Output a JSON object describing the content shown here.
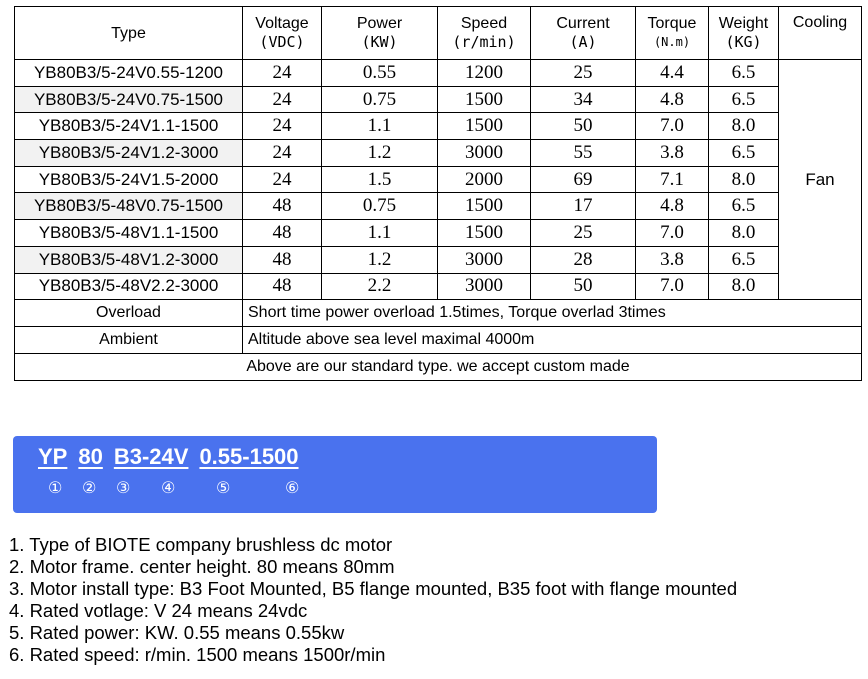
{
  "table": {
    "headers": [
      {
        "label": "Type",
        "unit": ""
      },
      {
        "label": "Voltage",
        "unit": "(VDC)"
      },
      {
        "label": "Power",
        "unit": "(KW)"
      },
      {
        "label": "Speed",
        "unit": "(r/min)"
      },
      {
        "label": "Current",
        "unit": "(A)"
      },
      {
        "label": "Torque",
        "unit": "(N.m)"
      },
      {
        "label": "Weight",
        "unit": "(KG)"
      },
      {
        "label": "Cooling",
        "unit": ""
      }
    ],
    "rows": [
      [
        "YB80B3/5-24V0.55-1200",
        "24",
        "0.55",
        "1200",
        "25",
        "4.4",
        "6.5"
      ],
      [
        "YB80B3/5-24V0.75-1500",
        "24",
        "0.75",
        "1500",
        "34",
        "4.8",
        "6.5"
      ],
      [
        "YB80B3/5-24V1.1-1500",
        "24",
        "1.1",
        "1500",
        "50",
        "7.0",
        "8.0"
      ],
      [
        "YB80B3/5-24V1.2-3000",
        "24",
        "1.2",
        "3000",
        "55",
        "3.8",
        "6.5"
      ],
      [
        "YB80B3/5-24V1.5-2000",
        "24",
        "1.5",
        "2000",
        "69",
        "7.1",
        "8.0"
      ],
      [
        "YB80B3/5-48V0.75-1500",
        "48",
        "0.75",
        "1500",
        "17",
        "4.8",
        "6.5"
      ],
      [
        "YB80B3/5-48V1.1-1500",
        "48",
        "1.1",
        "1500",
        "25",
        "7.0",
        "8.0"
      ],
      [
        "YB80B3/5-48V1.2-3000",
        "48",
        "1.2",
        "3000",
        "28",
        "3.8",
        "6.5"
      ],
      [
        "YB80B3/5-48V2.2-3000",
        "48",
        "2.2",
        "3000",
        "50",
        "7.0",
        "8.0"
      ]
    ],
    "cooling": "Fan",
    "overload_label": "Overload",
    "overload_text": "Short time power overload 1.5times, Torque overlad 3times",
    "ambient_label": "Ambient",
    "ambient_text": "Altitude above sea level maximal 4000m",
    "footer": "Above are our standard type. we accept custom made"
  },
  "code": {
    "segments": [
      "YP",
      "80",
      "B3-24V",
      "0.55-1500"
    ],
    "markers": [
      "①",
      "②",
      "③",
      "④",
      "⑤",
      "⑥"
    ]
  },
  "notes": [
    "1. Type of BIOTE company brushless dc motor",
    "2. Motor frame. center height. 80 means 80mm",
    "3. Motor install type: B3 Foot Mounted, B5 flange mounted, B35 foot with flange mounted",
    "4. Rated votlage: V 24 means 24vdc",
    "5. Rated power: KW. 0.55 means 0.55kw",
    "6. Rated speed: r/min. 1500 means 1500r/min"
  ],
  "colors": {
    "code_box": "#4a72ee",
    "row_shade": "#f2f2f2"
  }
}
